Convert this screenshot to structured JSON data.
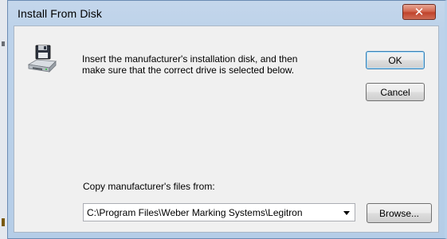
{
  "window": {
    "title": "Install From Disk",
    "close_symbol": "✕"
  },
  "content": {
    "icon": "floppy-disk-drive-icon",
    "message_line1": "Insert the manufacturer's installation disk, and then",
    "message_line2": "make sure that the correct drive is selected below."
  },
  "buttons": {
    "ok": "OK",
    "cancel": "Cancel",
    "browse": "Browse..."
  },
  "source": {
    "label": "Copy manufacturer's files from:",
    "path": "C:\\Program Files\\Weber Marking Systems\\Legitron"
  },
  "colors": {
    "titlebar": "#bcd2ea",
    "close_button": "#c9503a",
    "client_background": "#f0f0f0",
    "default_button_border": "#3c7fb1"
  }
}
